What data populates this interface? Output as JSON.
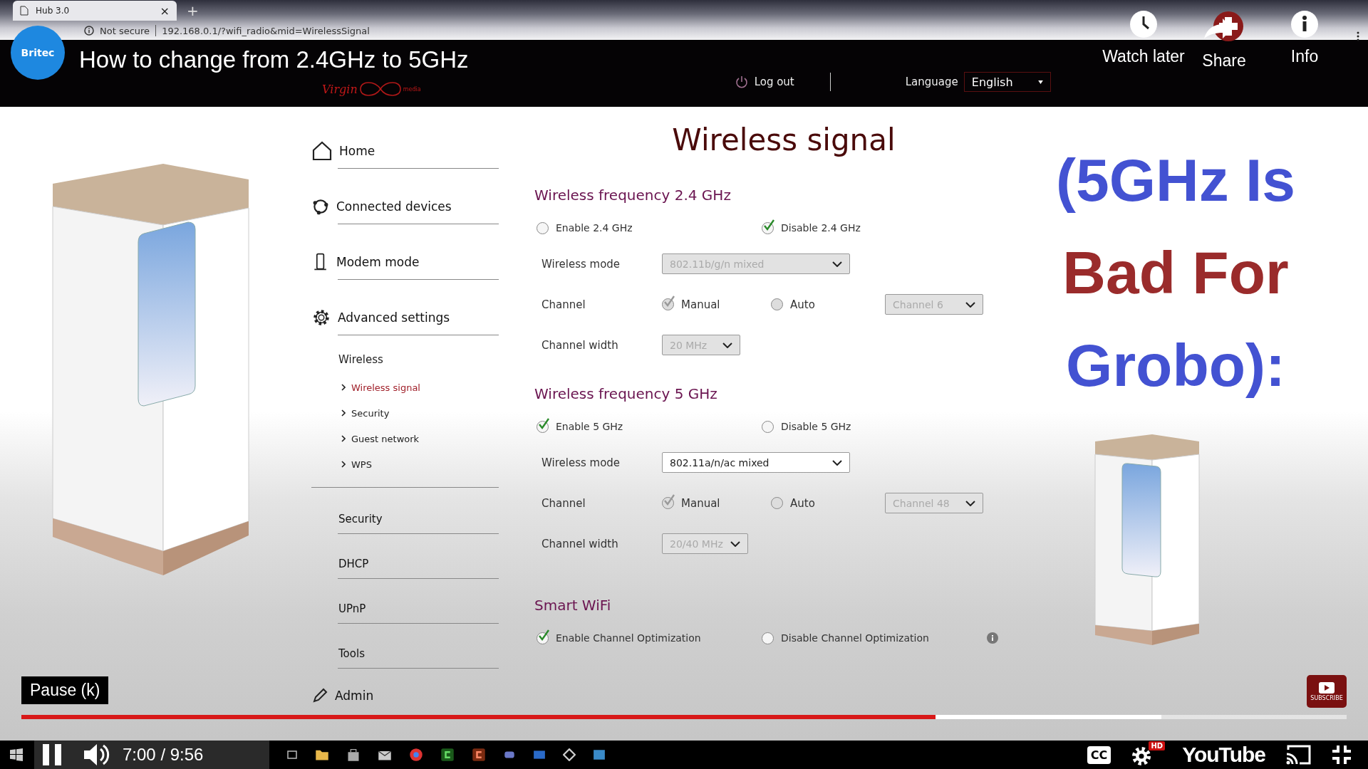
{
  "browser": {
    "tab_title": "Hub 3.0",
    "tab_close": "×",
    "new_tab": "+",
    "security": "Not secure",
    "url": "192.168.0.1/?wifi_radio&mid=WirelessSignal"
  },
  "router_header": {
    "logo_script": "Virgin",
    "logo_small": "media",
    "logout": "Log out",
    "language_label": "Language",
    "language": "English"
  },
  "sidebar": {
    "items": [
      {
        "label": "Home",
        "kind": "home"
      },
      {
        "label": "Connected devices",
        "kind": "devices"
      },
      {
        "label": "Modem mode",
        "kind": "modem"
      },
      {
        "label": "Advanced settings",
        "kind": "settings"
      }
    ],
    "group": {
      "heading": "Wireless",
      "children": [
        {
          "label": "Wireless signal",
          "selected": true
        },
        {
          "label": "Security",
          "selected": false
        },
        {
          "label": "Guest network",
          "selected": false
        },
        {
          "label": "WPS",
          "selected": false
        }
      ]
    },
    "more": [
      {
        "label": "Security",
        "kind": "plain"
      },
      {
        "label": "DHCP",
        "kind": "plain"
      },
      {
        "label": "UPnP",
        "kind": "plain"
      },
      {
        "label": "Tools",
        "kind": "plain"
      },
      {
        "label": "Admin",
        "kind": "admin"
      }
    ]
  },
  "page_title": "Wireless signal",
  "sections": [
    {
      "heading": "Wireless frequency 2.4 GHz",
      "toggles": [
        {
          "label": "Enable 2.4 GHz",
          "checked": false
        },
        {
          "label": "Disable 2.4 GHz",
          "checked": true
        }
      ],
      "mode": {
        "label": "Wireless mode",
        "value": "802.11b/g/n mixed",
        "disabled": true
      },
      "channel": {
        "label": "Channel",
        "disabled": true,
        "options": [
          {
            "label": "Manual",
            "selected": true
          },
          {
            "label": "Auto",
            "selected": false
          }
        ],
        "value": "Channel 6"
      },
      "width": {
        "label": "Channel width",
        "value": "20 MHz",
        "disabled": true
      }
    },
    {
      "heading": "Wireless frequency 5 GHz",
      "toggles": [
        {
          "label": "Enable 5 GHz",
          "checked": true
        },
        {
          "label": "Disable 5 GHz",
          "checked": false
        }
      ],
      "mode": {
        "label": "Wireless mode",
        "value": "802.11a/n/ac mixed",
        "disabled": false
      },
      "channel": {
        "label": "Channel",
        "disabled": true,
        "options": [
          {
            "label": "Manual",
            "selected": true
          },
          {
            "label": "Auto",
            "selected": false
          }
        ],
        "value": "Channel 48"
      },
      "width": {
        "label": "Channel width",
        "value": "20/40 MHz",
        "disabled": true
      }
    }
  ],
  "smart_wifi": {
    "heading": "Smart WiFi",
    "toggles": [
      {
        "label": "Enable Channel Optimization",
        "checked": true
      },
      {
        "label": "Disable Channel Optimization",
        "checked": false
      }
    ]
  },
  "video": {
    "title": "How to change from 2.4GHz to 5GHz",
    "channel_logo": "Britec",
    "actions": [
      {
        "label": "Watch later",
        "kind": "clock"
      },
      {
        "label": "Share",
        "kind": "share"
      },
      {
        "label": "Info",
        "kind": "info"
      }
    ],
    "overlay_lines": [
      {
        "text": "(5GHz Is",
        "color": "#4352d2"
      },
      {
        "text": "Bad For",
        "color": "#9a2b2b"
      },
      {
        "text": "Grobo):",
        "color": "#4352d2"
      }
    ],
    "tooltip": "Pause (k)",
    "subscribe": "SUBSCRIBE",
    "progress": {
      "level": 0.69
    },
    "loaded": {
      "level": 0.86
    },
    "time": "7:00 / 9:56",
    "cc": "CC",
    "hd": "HD",
    "brand": "YouTube"
  }
}
